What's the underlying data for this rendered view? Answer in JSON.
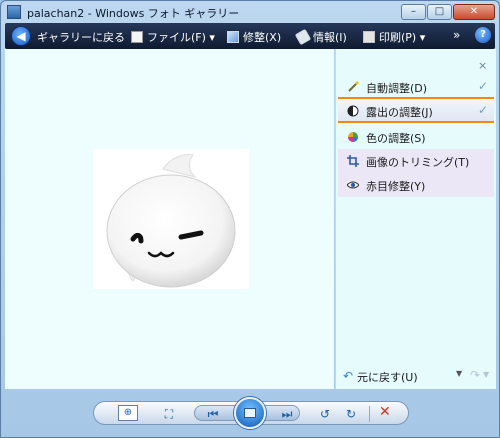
{
  "window": {
    "title": "palachan2 - Windows フォト ギャラリー",
    "minimize_glyph": "–",
    "maximize_glyph": "□",
    "close_glyph": "✕"
  },
  "toolbar": {
    "back_label": "ギャラリーに戻る",
    "file_label": "ファイル(F) ▾",
    "fix_label": "修整(X)",
    "info_label": "情報(I)",
    "print_label": "印刷(P) ▾",
    "more_label": "»",
    "help_label": "?"
  },
  "panel": {
    "close_glyph": "×",
    "items": [
      {
        "label": "自動調整(D)",
        "icon": "magic-wand-icon",
        "checked": true
      },
      {
        "label": "露出の調整(J)",
        "icon": "exposure-icon",
        "checked": true
      },
      {
        "label": "色の調整(S)",
        "icon": "color-wheel-icon",
        "checked": false
      },
      {
        "label": "画像のトリミング(T)",
        "icon": "crop-icon",
        "checked": false
      },
      {
        "label": "赤目修整(Y)",
        "icon": "eye-icon",
        "checked": false
      }
    ],
    "check_glyph": "✓",
    "undo_label": "元に戻す(U)",
    "undo_glyph": "↶",
    "redo_glyph": "↷",
    "dropdown_glyph": "▼"
  },
  "bottom": {
    "zoom_glyph": "⊕",
    "fit_glyph": "⛶",
    "prev_glyph": "⏮",
    "next_glyph": "⏭",
    "rotate_ccw_glyph": "↺",
    "rotate_cw_glyph": "↻",
    "delete_glyph": "✕"
  },
  "colors": {
    "toolbar_bg": "#132241",
    "viewer_bg": "#eefdfd",
    "highlight_line": "#ef8a12",
    "delete_red": "#d0321f"
  }
}
